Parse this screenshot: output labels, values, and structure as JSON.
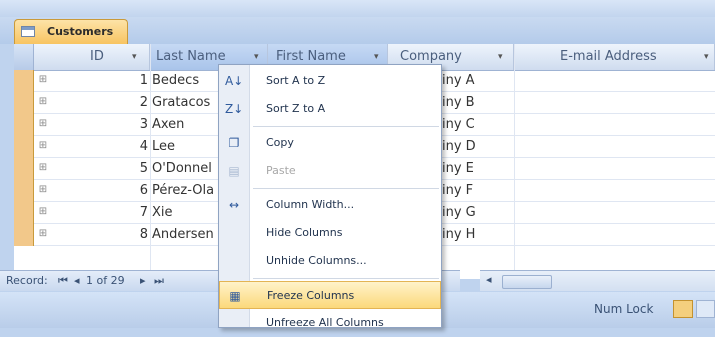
{
  "tab": {
    "label": "Customers"
  },
  "columns": [
    {
      "label": "ID"
    },
    {
      "label": "Last Name"
    },
    {
      "label": "First Name"
    },
    {
      "label": "Company"
    },
    {
      "label": "E-mail Address"
    }
  ],
  "rows": [
    {
      "id": "1",
      "last_name": "Bedecs",
      "company": "iny A"
    },
    {
      "id": "2",
      "last_name": "Gratacos",
      "company": "iny B"
    },
    {
      "id": "3",
      "last_name": "Axen",
      "company": "iny C"
    },
    {
      "id": "4",
      "last_name": "Lee",
      "company": "iny D"
    },
    {
      "id": "5",
      "last_name": "O'Donnel",
      "company": "iny E"
    },
    {
      "id": "6",
      "last_name": "Pérez-Ola",
      "company": "iny F"
    },
    {
      "id": "7",
      "last_name": "Xie",
      "company": "iny G"
    },
    {
      "id": "8",
      "last_name": "Andersen",
      "company": "iny H"
    }
  ],
  "context_menu": {
    "items": [
      {
        "label": "Sort A to Z",
        "icon": "sort-ascending-icon"
      },
      {
        "label": "Sort Z to A",
        "icon": "sort-descending-icon"
      },
      {
        "label": "Copy",
        "icon": "copy-icon"
      },
      {
        "label": "Paste",
        "icon": "paste-icon",
        "disabled": true
      },
      {
        "label": "Column Width...",
        "icon": "column-width-icon"
      },
      {
        "label": "Hide Columns"
      },
      {
        "label": "Unhide Columns..."
      },
      {
        "label": "Freeze Columns",
        "icon": "freeze-columns-icon",
        "highlighted": true
      },
      {
        "label": "Unfreeze All Columns"
      }
    ]
  },
  "navigation": {
    "record_label": "Record:",
    "position": "1 of 29"
  },
  "status": {
    "num_lock": "Num Lock"
  },
  "colors": {
    "tab_accent": "#f7c35f",
    "menu_highlight": "#fbd97b",
    "header_blue": "#cfdcef"
  }
}
